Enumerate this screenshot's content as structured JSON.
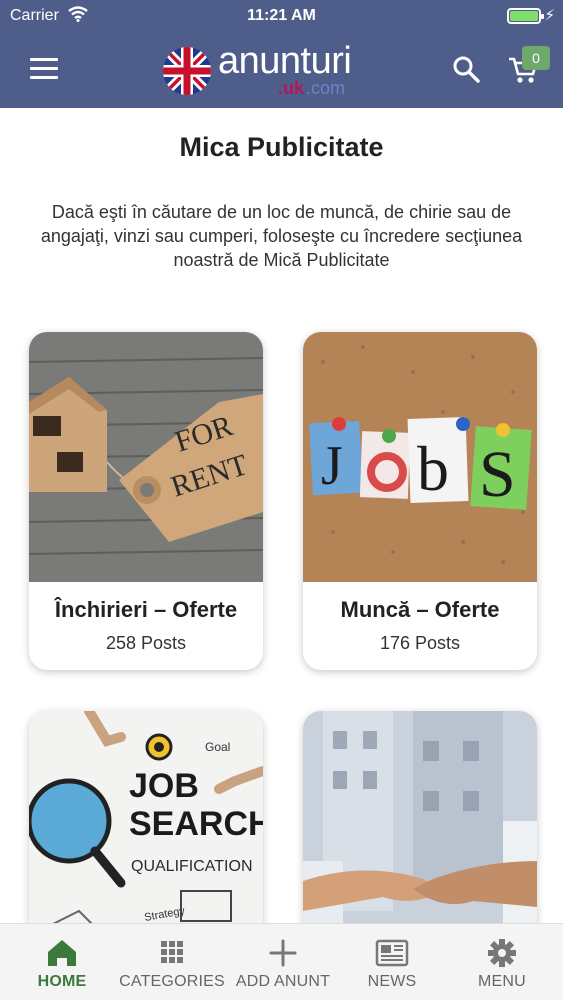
{
  "status_bar": {
    "carrier": "Carrier",
    "time": "11:21 AM",
    "battery_level": 1.0
  },
  "header": {
    "logo_text": "anunturi",
    "logo_sub": ".uk",
    "logo_sub2": ".com",
    "cart_count": "0"
  },
  "main": {
    "title": "Mica Publicitate",
    "intro": "Dacă eşti în căutare de un loc de muncă, de chirie sau de angajaţi, vinzi sau cumperi, foloseşte cu încredere secţiunea noastră de Mică Publicitate"
  },
  "cards": [
    {
      "title": "Închirieri – Oferte",
      "posts": "258 Posts",
      "image_text": [
        "FOR",
        "RENT"
      ]
    },
    {
      "title": "Muncă – Oferte",
      "posts": "176 Posts",
      "image_text": [
        "J",
        "o",
        "b",
        "S"
      ]
    },
    {
      "title": "",
      "posts": "",
      "image_text": [
        "JOB",
        "SEARCH",
        "QUALIFICATION",
        "Goal",
        "Strategy"
      ]
    },
    {
      "title": "",
      "posts": "",
      "image_text": []
    }
  ],
  "tabbar": {
    "tabs": [
      {
        "label": "HOME",
        "icon": "home-icon",
        "active": true
      },
      {
        "label": "CATEGORIES",
        "icon": "grid-icon",
        "active": false
      },
      {
        "label": "ADD ANUNT",
        "icon": "plus-icon",
        "active": false
      },
      {
        "label": "NEWS",
        "icon": "newspaper-icon",
        "active": false
      },
      {
        "label": "MENU",
        "icon": "gear-icon",
        "active": false
      }
    ]
  },
  "colors": {
    "header_bg": "#4f5d8a",
    "active_tab": "#3c7a3c",
    "badge": "#6da96a",
    "battery": "#7ee06b"
  }
}
